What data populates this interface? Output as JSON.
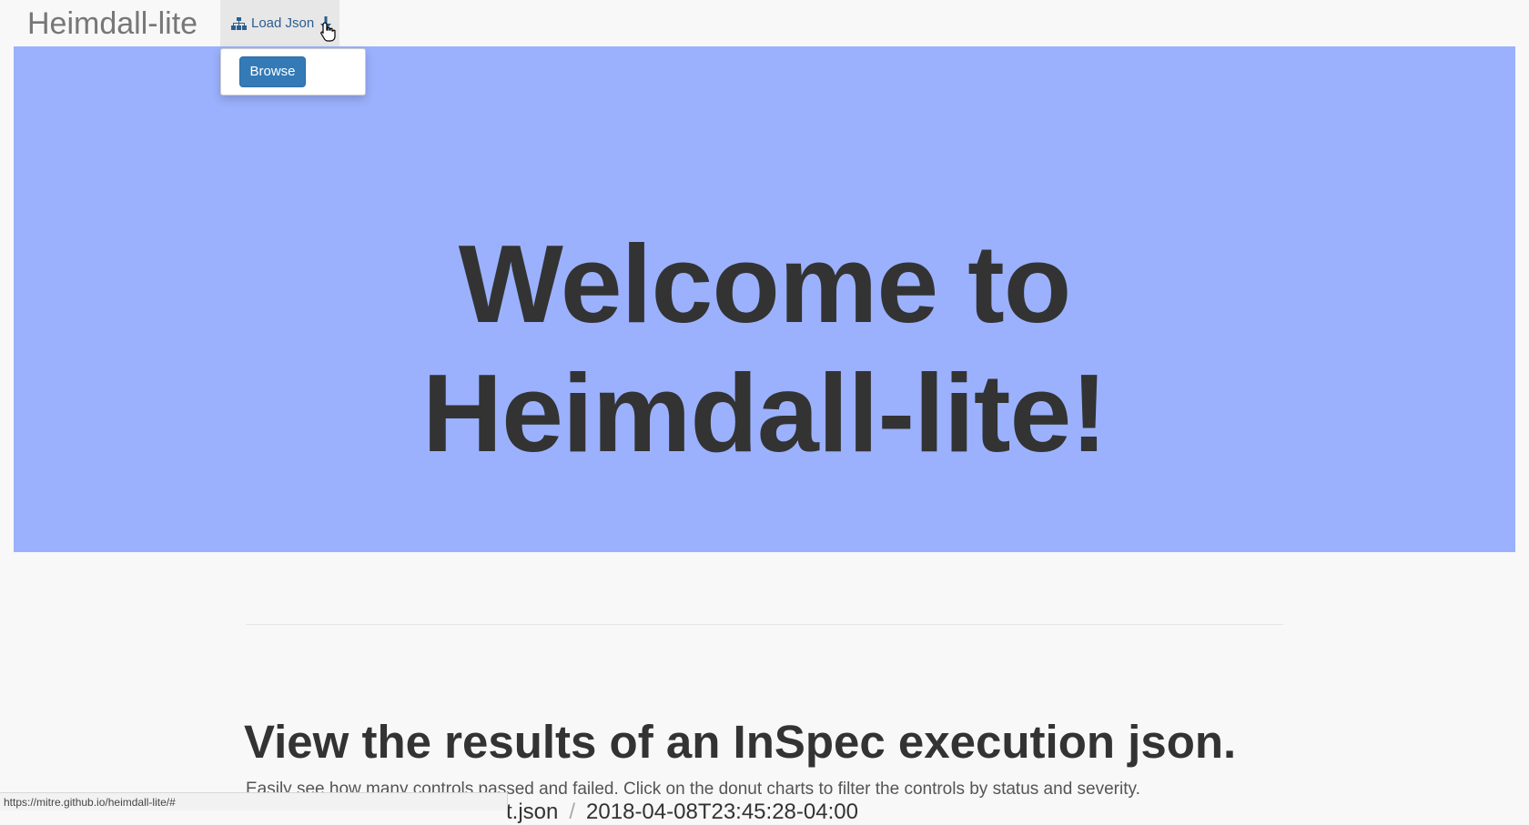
{
  "navbar": {
    "brand": "Heimdall-lite",
    "load_json_label": "Load Json"
  },
  "dropdown": {
    "browse_label": "Browse"
  },
  "jumbotron": {
    "line1": "Welcome to",
    "line2": "Heimdall-lite!",
    "background_color": "#9bb1fd"
  },
  "section": {
    "heading": "View the results of an InSpec execution json.",
    "subtext": "Easily see how many controls passed and failed. Click on the donut charts to filter the controls by status and severity.",
    "partial_filename": "t.json",
    "partial_separator": "/",
    "partial_timestamp": "2018-04-08T23:45:28-04:00"
  },
  "status_bar": {
    "url": "https://mitre.github.io/heimdall-lite/#"
  },
  "icons": {
    "load_json": "sitemap-icon",
    "toggle": "arrow-down-icon",
    "cursor": "pointer-cursor-icon"
  },
  "colors": {
    "accent": "#337ab7",
    "link": "#2b5f8f"
  }
}
